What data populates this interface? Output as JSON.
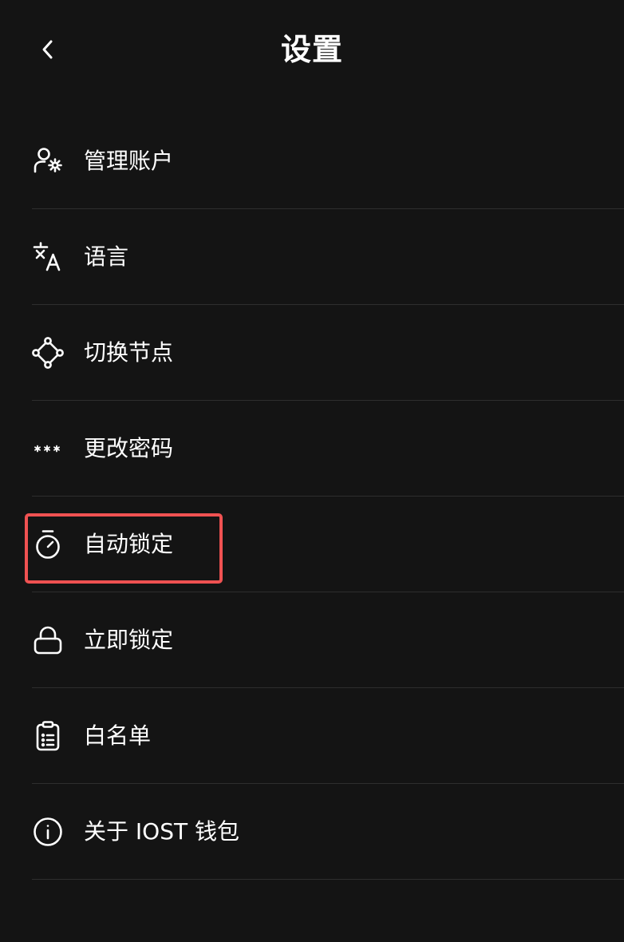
{
  "header": {
    "title": "设置",
    "back_icon": "chevron-left-icon"
  },
  "menu": {
    "items": [
      {
        "label": "管理账户",
        "icon": "user-gear-icon"
      },
      {
        "label": "语言",
        "icon": "translate-icon"
      },
      {
        "label": "切换节点",
        "icon": "nodes-icon"
      },
      {
        "label": "更改密码",
        "icon": "password-dots-icon"
      },
      {
        "label": "自动锁定",
        "icon": "timer-icon"
      },
      {
        "label": "立即锁定",
        "icon": "lock-icon"
      },
      {
        "label": "白名单",
        "icon": "clipboard-list-icon"
      },
      {
        "label": "关于 IOST 钱包",
        "icon": "info-icon"
      }
    ]
  },
  "colors": {
    "background": "#141414",
    "text": "#ffffff",
    "divider": "#2e2e2e",
    "highlight": "#f05252"
  }
}
